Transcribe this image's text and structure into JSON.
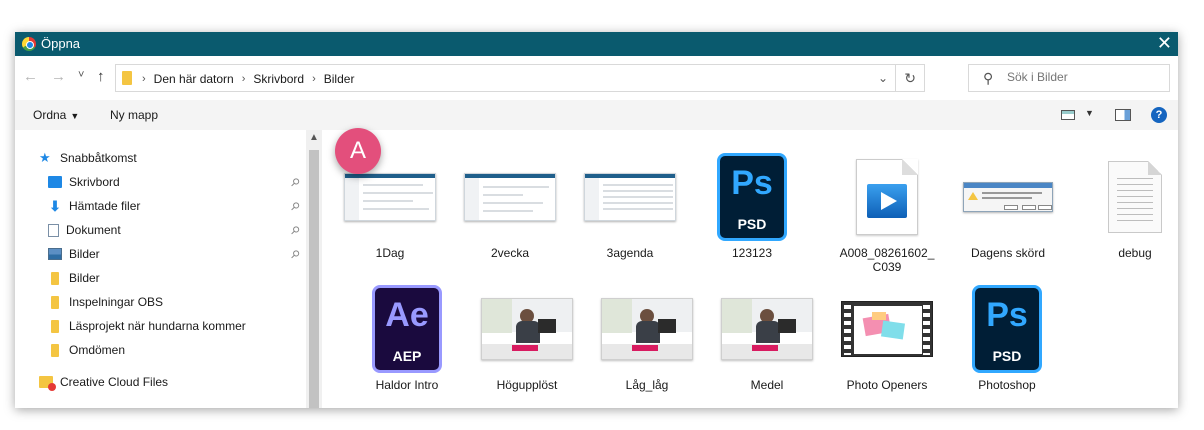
{
  "window": {
    "title": "Öppna",
    "close_glyph": "✕"
  },
  "nav": {
    "back": "←",
    "forward": "→",
    "recent": "˅",
    "up": "↑"
  },
  "address": {
    "breadcrumbs": [
      "Den här datorn",
      "Skrivbord",
      "Bilder"
    ],
    "separator": "›",
    "dropdown": "⌄",
    "refresh": "↻"
  },
  "search": {
    "placeholder": "Sök i Bilder"
  },
  "toolbar": {
    "organize": "Ordna",
    "new_folder": "Ny mapp",
    "help": "?"
  },
  "sidebar": {
    "items": [
      {
        "label": "Snabbåtkomst",
        "icon": "star-icon",
        "pinned": false
      },
      {
        "label": "Skrivbord",
        "icon": "desktop-icon",
        "pinned": true
      },
      {
        "label": "Hämtade filer",
        "icon": "download-icon",
        "pinned": true
      },
      {
        "label": "Dokument",
        "icon": "document-icon",
        "pinned": true
      },
      {
        "label": "Bilder",
        "icon": "pictures-icon",
        "pinned": true
      },
      {
        "label": "Bilder",
        "icon": "folder-icon",
        "pinned": false
      },
      {
        "label": "Inspelningar OBS",
        "icon": "folder-icon",
        "pinned": false
      },
      {
        "label": "Läsprojekt när hundarna kommer",
        "icon": "folder-icon",
        "pinned": false
      },
      {
        "label": "Omdömen",
        "icon": "folder-icon",
        "pinned": false
      },
      {
        "label": "Creative Cloud Files",
        "icon": "creative-cloud-icon",
        "pinned": false
      }
    ]
  },
  "files": [
    {
      "name": "1Dag",
      "kind": "screenshot"
    },
    {
      "name": "2vecka",
      "kind": "screenshot"
    },
    {
      "name": "3agenda",
      "kind": "screenshot"
    },
    {
      "name": "123123",
      "kind": "psd",
      "icon_main": "Ps",
      "icon_sub": "PSD"
    },
    {
      "name": "A008_08261602_C039",
      "kind": "video"
    },
    {
      "name": "Dagens skörd",
      "kind": "dialog-screenshot"
    },
    {
      "name": "debug",
      "kind": "text"
    },
    {
      "name": "Haldor Intro",
      "kind": "aep",
      "icon_main": "Ae",
      "icon_sub": "AEP"
    },
    {
      "name": "Högupplöst",
      "kind": "photo"
    },
    {
      "name": "Låg_låg",
      "kind": "photo"
    },
    {
      "name": "Medel",
      "kind": "photo"
    },
    {
      "name": "Photo Openers",
      "kind": "film"
    },
    {
      "name": "Photoshop",
      "kind": "psd",
      "icon_main": "Ps",
      "icon_sub": "PSD"
    }
  ],
  "annotation": {
    "badge": "A"
  },
  "colors": {
    "titlebar": "#0a5a6e",
    "accent": "#1e88e5",
    "badge": "#e34f7c",
    "ps_blue": "#31a8ff",
    "ae_purple": "#9999ff"
  }
}
